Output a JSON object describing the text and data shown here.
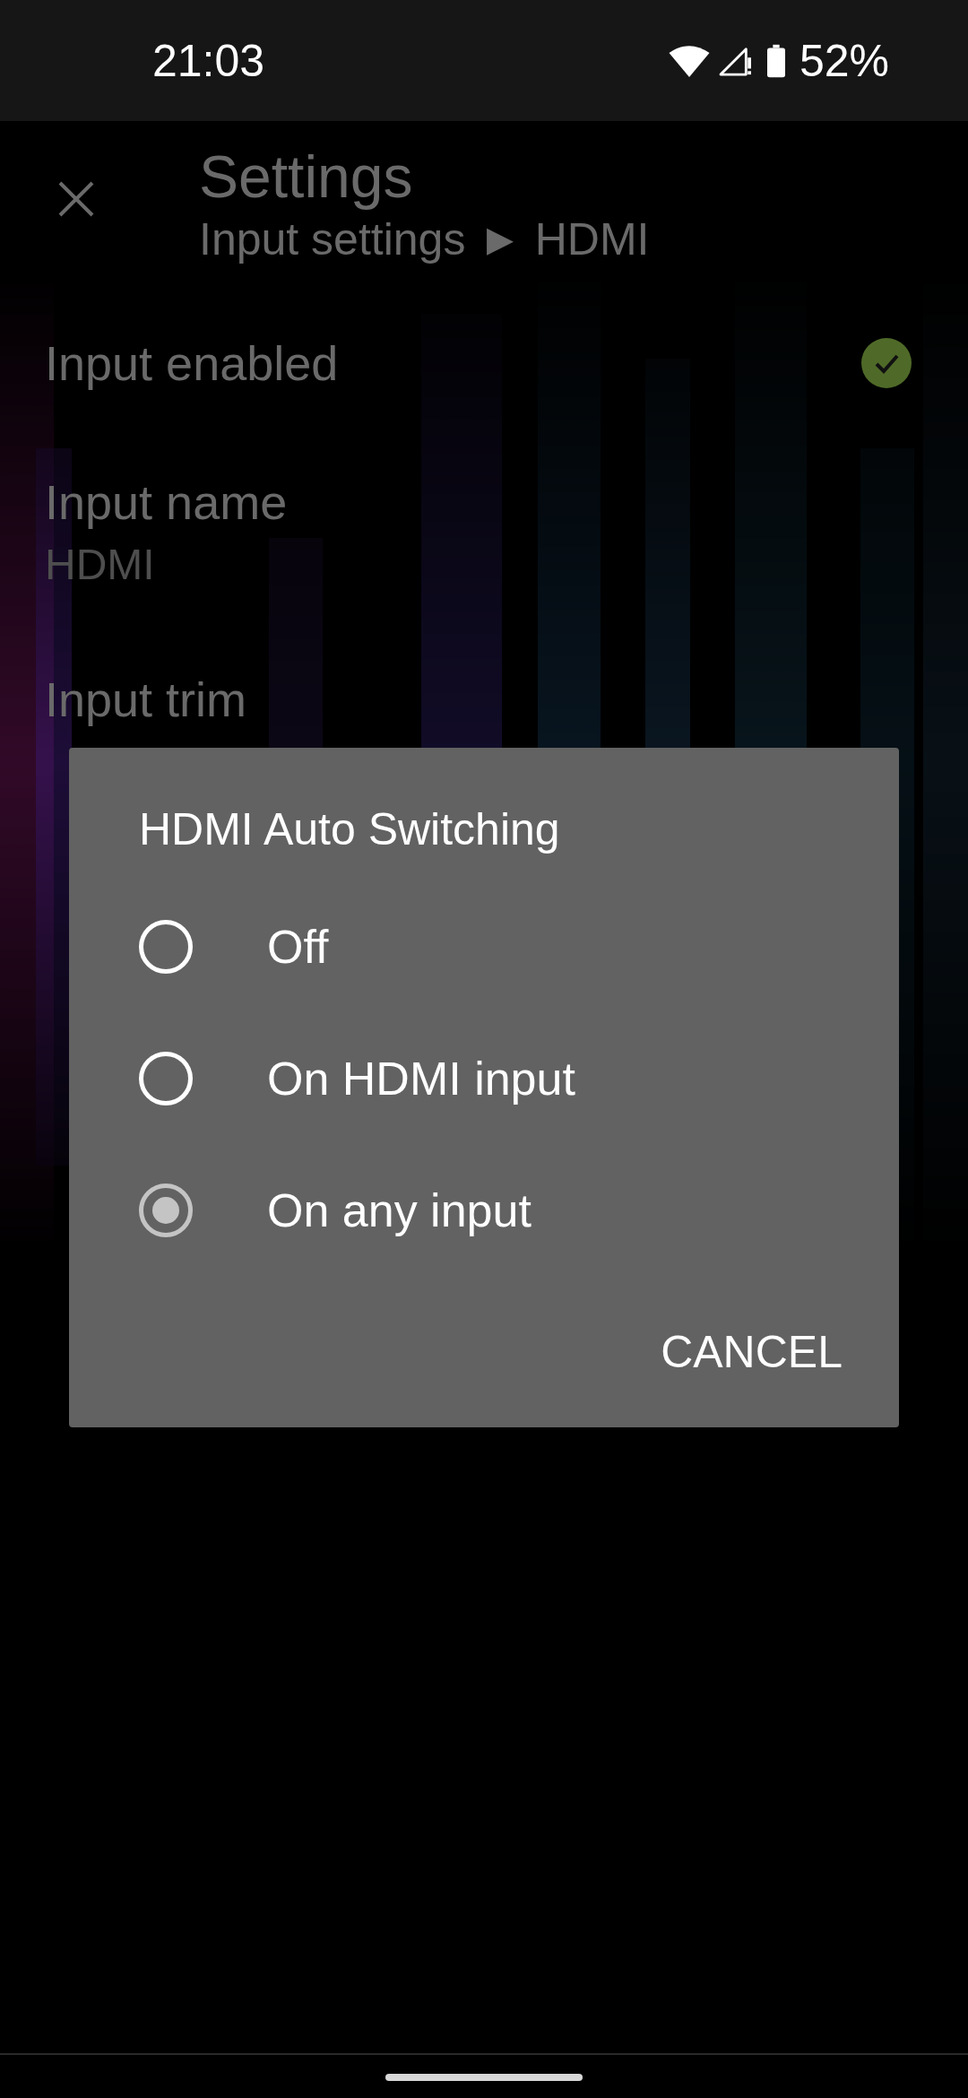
{
  "status_bar": {
    "time": "21:03",
    "battery": "52%"
  },
  "header": {
    "title": "Settings",
    "breadcrumb": "Input settings ► HDMI"
  },
  "settings": [
    {
      "kind": "checkbox",
      "label": "Input enabled",
      "checked": true
    },
    {
      "kind": "value",
      "label": "Input name",
      "value": "HDMI"
    },
    {
      "kind": "heading",
      "label": "Input trim"
    }
  ],
  "dialog": {
    "title": "HDMI Auto Switching",
    "options": [
      {
        "label": "Off",
        "selected": false
      },
      {
        "label": "On HDMI input",
        "selected": false
      },
      {
        "label": "On any input",
        "selected": true
      }
    ],
    "cancel": "CANCEL"
  }
}
